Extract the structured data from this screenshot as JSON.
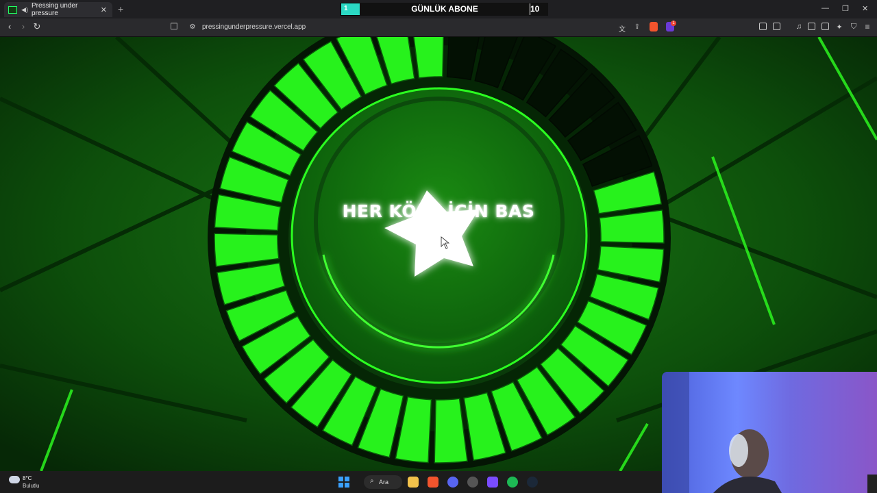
{
  "browser": {
    "tab_title": "Pressing under pressure",
    "new_tab_icon": "+",
    "url": "pressingunderpressure.vercel.app",
    "shield_badge": "",
    "notif_badge": "1"
  },
  "subscriber_widget": {
    "label": "GÜNLÜK ABONE",
    "current": "1",
    "target": "10",
    "progress": 0.1,
    "fill_color": "#2bd9c4"
  },
  "game": {
    "prompt": "HER KÖŞE İÇİN BAS",
    "ring_segments_total": 36,
    "ring_segments_filled": 29,
    "accent": "#27f21c",
    "icon": "star-icon"
  },
  "taskbar": {
    "weather_temp": "8°C",
    "weather_desc": "Bulutlu",
    "search_label": "Ara"
  }
}
